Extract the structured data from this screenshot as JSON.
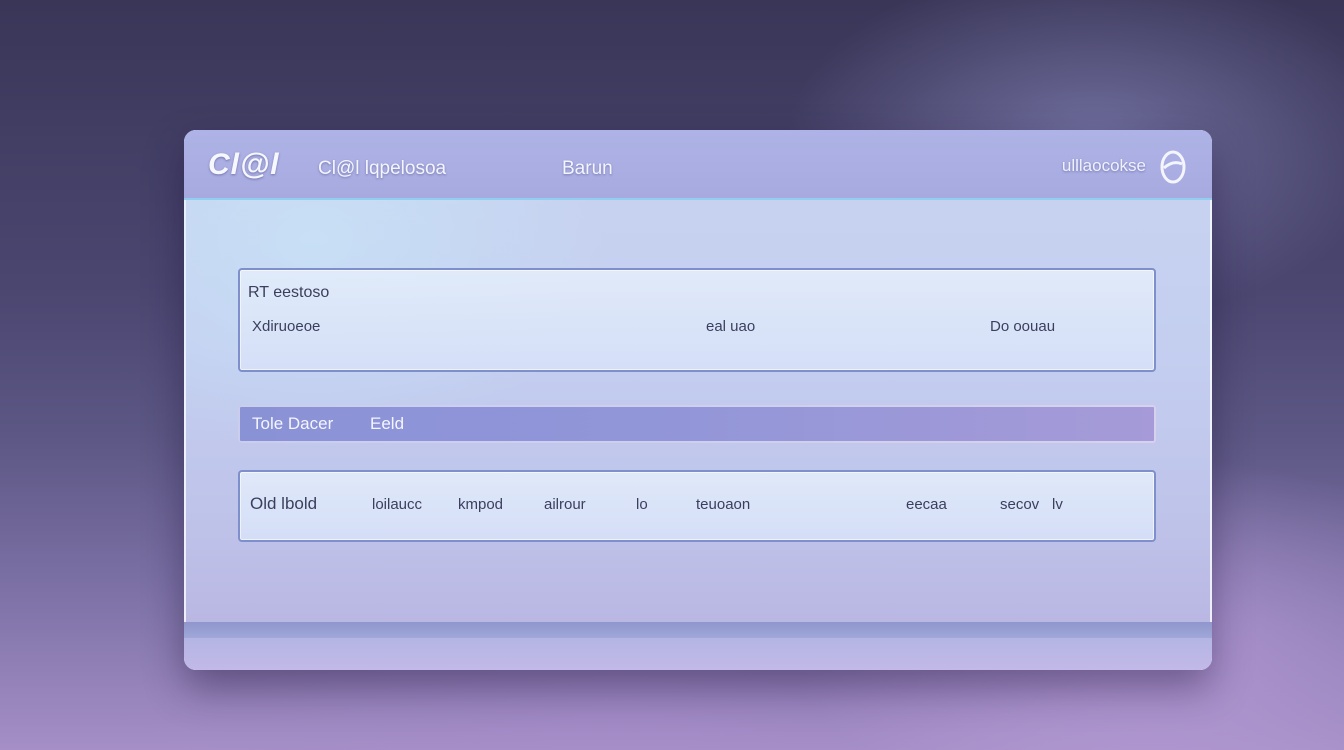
{
  "app": {
    "logo": "Cl@l",
    "name": "Cl@l lqpelosoa",
    "title": "Barun",
    "account_label": "ulllaocokse",
    "brand_icon": "e-logo-icon"
  },
  "info_panel": {
    "heading": "RT eestoso",
    "fields": [
      "Xdiruoeoe",
      "eal uao",
      "Do oouau"
    ]
  },
  "band": {
    "title": "Tole Dacer",
    "value": "Eeld"
  },
  "row_panel": {
    "cells": [
      "Old lbold",
      "loilaucc",
      "kmpod",
      "ailrour",
      "lo",
      "teuoaon",
      "eecaa",
      "secov",
      "lv"
    ]
  },
  "colors": {
    "titlebar": "#a9ace2",
    "band": "#8f95d7",
    "panel_border": "#7e8fcc",
    "accent_line": "#8cd2f0"
  }
}
